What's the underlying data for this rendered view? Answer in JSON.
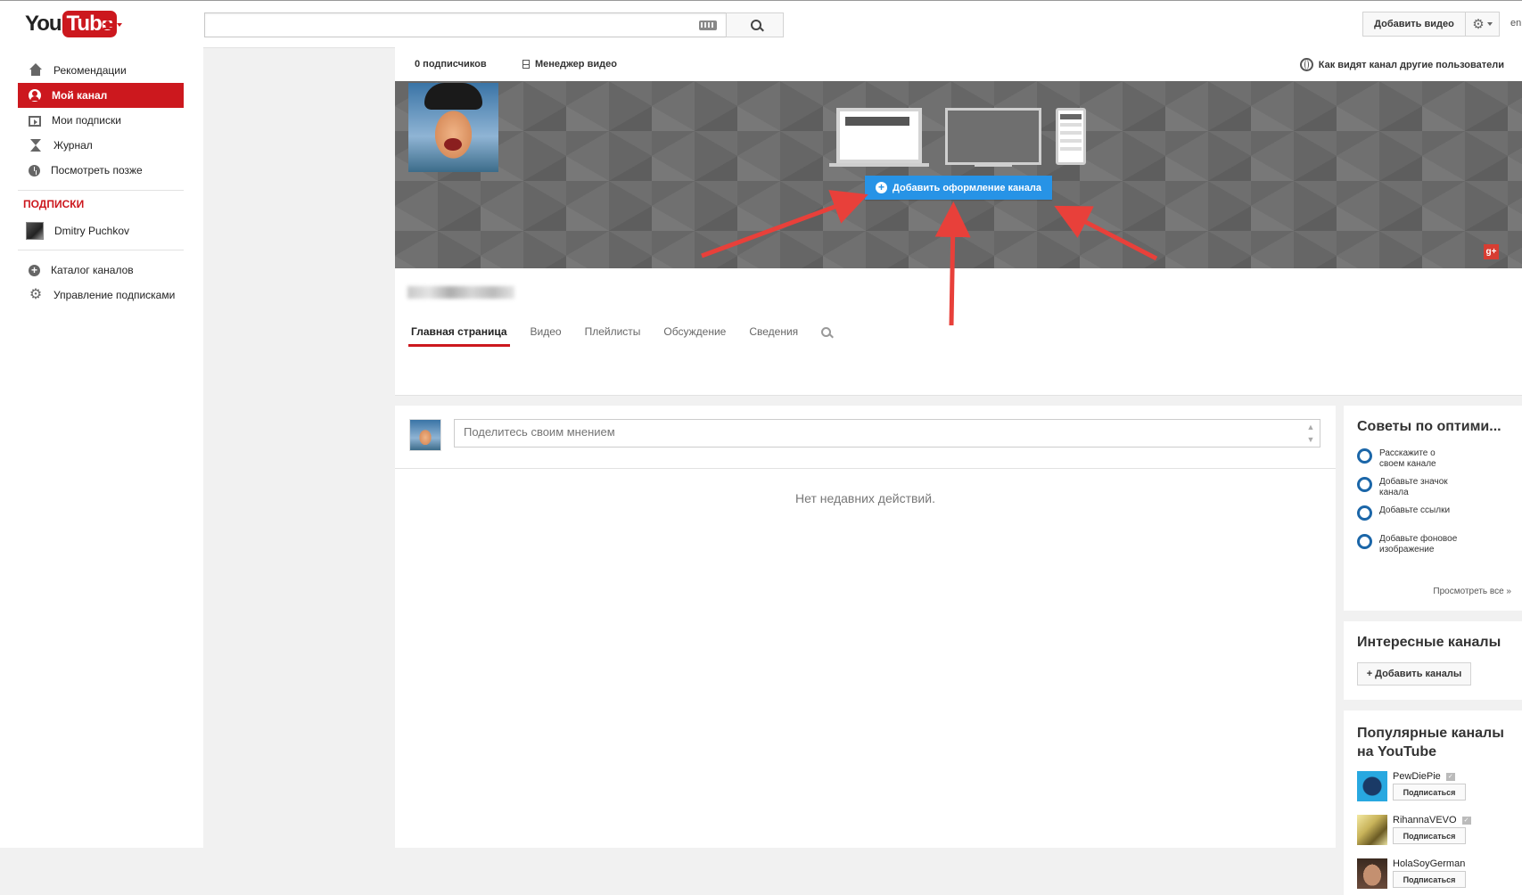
{
  "masthead": {
    "logo_you": "You",
    "logo_tube": "Tube",
    "search_placeholder": "",
    "upload_label": "Добавить видео",
    "user_cut": "en"
  },
  "guide": {
    "items": [
      {
        "label": "Рекомендации",
        "icon": "home-icon"
      },
      {
        "label": "Мой канал",
        "icon": "person-icon",
        "active": true
      },
      {
        "label": "Мои подписки",
        "icon": "subscriptions-icon"
      },
      {
        "label": "Журнал",
        "icon": "hourglass-icon"
      },
      {
        "label": "Посмотреть позже",
        "icon": "clock-icon"
      }
    ],
    "subscriptions_title": "подписки",
    "subscriptions": [
      {
        "label": "Dmitry Puchkov",
        "icon": "channel-avatar"
      }
    ],
    "footer_items": [
      {
        "label": "Каталог каналов",
        "icon": "plus-circle-icon"
      },
      {
        "label": "Управление подписками",
        "icon": "gear-icon"
      }
    ]
  },
  "channel": {
    "subscribers": "0 подписчиков",
    "video_manager": "Менеджер видео",
    "view_as": "Как видят канал другие пользователи",
    "add_art_label": "Добавить оформление канала",
    "gplus": "g+",
    "tabs": [
      "Главная страница",
      "Видео",
      "Плейлисты",
      "Обсуждение",
      "Сведения"
    ]
  },
  "feed": {
    "share_placeholder": "Поделитесь своим мнением",
    "empty_text": "Нет недавних действий."
  },
  "sidebar": {
    "tips_title": "Советы по оптими...",
    "tips": [
      "Расскажите о своем канале",
      "Добавьте значок канала",
      "Добавьте ссылки",
      "Добавьте фоновое изображение"
    ],
    "see_all": "Просмотреть все »",
    "interesting_title": "Интересные каналы",
    "add_channels": "+ Добавить каналы",
    "popular_title": "Популярные каналы на YouTube",
    "popular": [
      {
        "name": "PewDiePie",
        "button": "Подписаться"
      },
      {
        "name": "RihannaVEVO",
        "button": "Подписаться"
      },
      {
        "name": "HolaSoyGerman",
        "button": "Подписаться"
      }
    ]
  },
  "colors": {
    "brand_red": "#cc181e",
    "accent_blue": "#2793e6",
    "annotation_red": "#e8403a"
  }
}
